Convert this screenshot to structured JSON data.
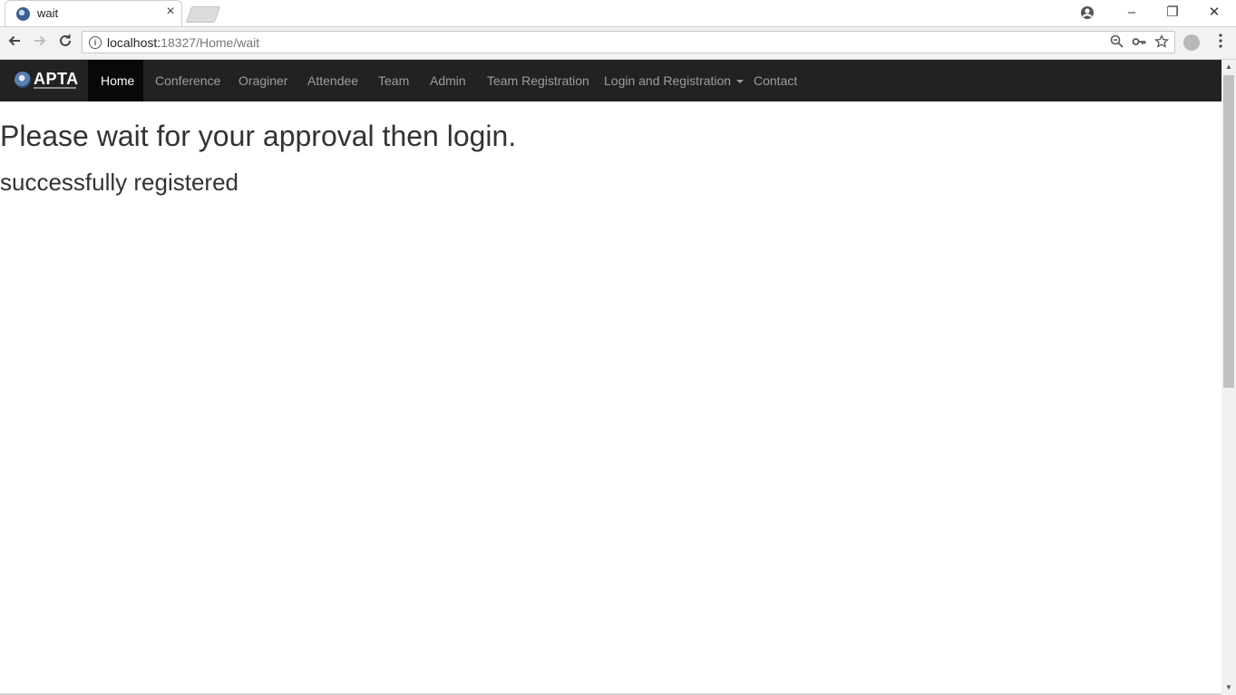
{
  "browser": {
    "tab_title": "wait",
    "tab_close": "×",
    "url_host": "localhost:",
    "url_rest": "18327/Home/wait",
    "icons": {
      "back": "arrow-left-icon",
      "forward": "arrow-right-icon",
      "reload": "reload-icon",
      "info": "info-icon",
      "zoom": "zoom-icon",
      "key": "key-icon",
      "star": "star-icon",
      "profile": "profile-icon",
      "menu": "more-vert-icon"
    },
    "window": {
      "minimize": "–",
      "restore": "❐",
      "close": "✕"
    }
  },
  "navbar": {
    "brand": "APTA",
    "items": [
      {
        "label": "Home",
        "active": true
      },
      {
        "label": "Conference"
      },
      {
        "label": "Oraginer"
      },
      {
        "label": "Attendee"
      },
      {
        "label": "Team"
      },
      {
        "label": "Admin"
      },
      {
        "label": "Team Registration"
      },
      {
        "label": "Login and Registration",
        "dropdown": true
      },
      {
        "label": "Contact"
      }
    ]
  },
  "main": {
    "heading": "Please wait for your approval then login.",
    "message": "successfully registered"
  }
}
